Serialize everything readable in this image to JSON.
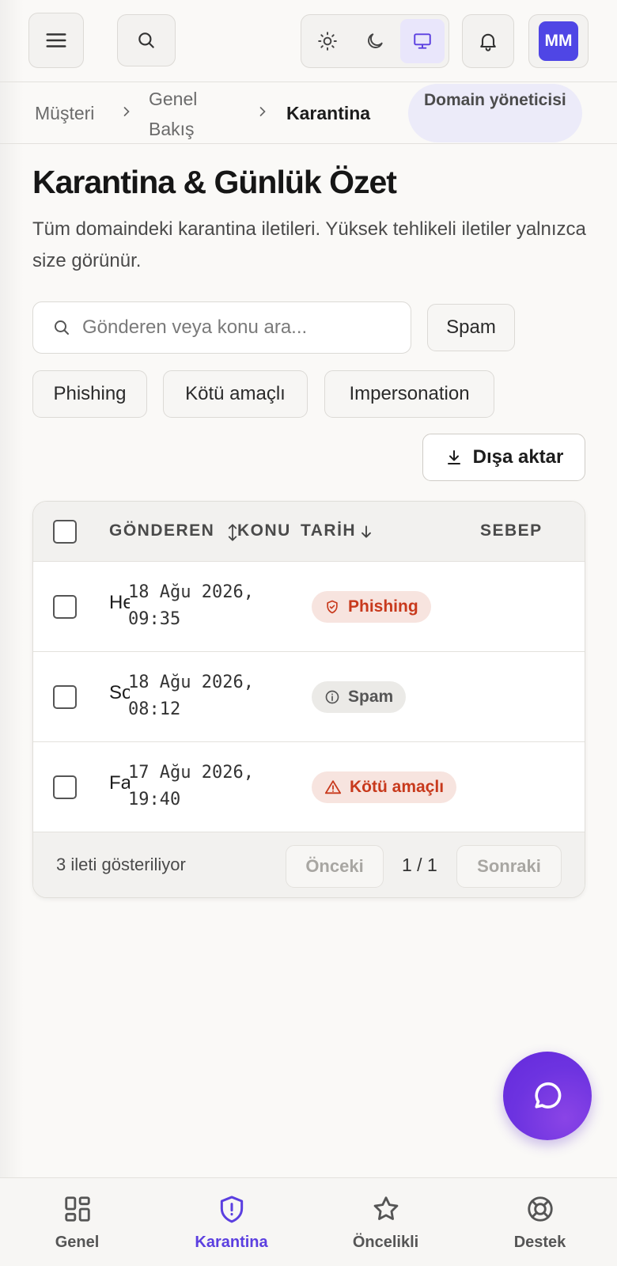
{
  "topbar": {
    "avatar_initials": "MM",
    "icons": [
      "menu-icon",
      "search-icon",
      "sun-icon",
      "moon-icon",
      "monitor-icon",
      "bell-icon"
    ]
  },
  "breadcrumb": {
    "items": [
      "Müşteri",
      "Genel Bakış",
      "Karantina"
    ],
    "role_badge": "Domain yöneticisi"
  },
  "page": {
    "title": "Karantina & Günlük Özet",
    "description": "Tüm domaindeki karantina iletileri. Yüksek tehlikeli iletiler yalnızca size görünür."
  },
  "filters": {
    "search_placeholder": "Gönderen veya konu ara...",
    "chips": [
      "Spam",
      "Phishing",
      "Kötü amaçlı",
      "Impersonation"
    ],
    "export_label": "Dışa aktar"
  },
  "table": {
    "columns": {
      "sender": "GÖNDEREN",
      "subject": "KONU",
      "date": "TARİH",
      "reason": "SEBEP"
    },
    "rows": [
      {
        "sender": "He",
        "date": "18 Ağu 2026,\n09:35",
        "reason": "Phishing",
        "reason_icon": "shield-icon",
        "tone": "red"
      },
      {
        "sender": "So",
        "date": "18 Ağu 2026,\n08:12",
        "reason": "Spam",
        "reason_icon": "info-icon",
        "tone": "gray"
      },
      {
        "sender": "Fa",
        "date": "17 Ağu 2026,\n19:40",
        "reason": "Kötü amaçlı",
        "reason_icon": "warning-icon",
        "tone": "red"
      }
    ],
    "footer": {
      "count_text": "3 ileti gösteriliyor",
      "prev_label": "Önceki",
      "page_text": "1 / 1",
      "next_label": "Sonraki"
    }
  },
  "bottom_nav": {
    "items": [
      {
        "label": "Genel",
        "icon": "grid-icon"
      },
      {
        "label": "Karantina",
        "icon": "shield-alert-icon",
        "active": true
      },
      {
        "label": "Öncelikli",
        "icon": "star-icon"
      },
      {
        "label": "Destek",
        "icon": "lifebuoy-icon"
      }
    ]
  },
  "colors": {
    "accent": "#5b3fe0",
    "avatar": "#4f46e5",
    "danger": "#c8391c"
  }
}
